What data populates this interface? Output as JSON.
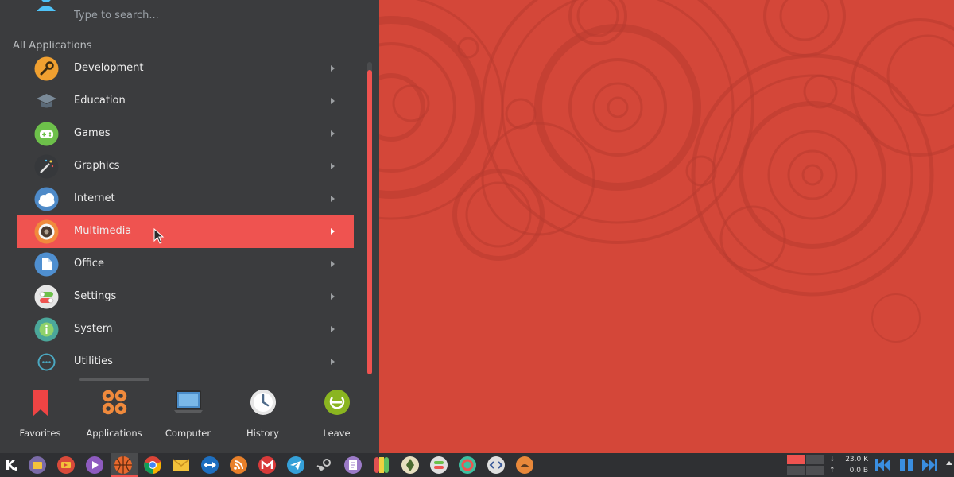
{
  "search": {
    "placeholder": "Type to search..."
  },
  "section_title": "All Applications",
  "categories": [
    {
      "label": "Development",
      "icon": "wrench-icon",
      "color": "#f0a030"
    },
    {
      "label": "Education",
      "icon": "graduation-cap-icon",
      "color": "#5b6a78"
    },
    {
      "label": "Games",
      "icon": "gamepad-icon",
      "color": "#6dc04a"
    },
    {
      "label": "Graphics",
      "icon": "magic-wand-icon",
      "color": "#3a3a3a"
    },
    {
      "label": "Internet",
      "icon": "cloud-globe-icon",
      "color": "#4e8ac8"
    },
    {
      "label": "Multimedia",
      "icon": "speaker-icon",
      "color": "#f08a3c",
      "active": true
    },
    {
      "label": "Office",
      "icon": "document-icon",
      "color": "#4f8fd0"
    },
    {
      "label": "Settings",
      "icon": "toggle-switches-icon",
      "color": "#e6e6e6"
    },
    {
      "label": "System",
      "icon": "info-icon",
      "color": "#4ba79a"
    },
    {
      "label": "Utilities",
      "icon": "dots-icon",
      "color": "#3a3a3a"
    }
  ],
  "bottom_nav": [
    {
      "label": "Favorites",
      "icon": "bookmark-icon"
    },
    {
      "label": "Applications",
      "icon": "applications-grid-icon"
    },
    {
      "label": "Computer",
      "icon": "laptop-icon"
    },
    {
      "label": "History",
      "icon": "clock-icon"
    },
    {
      "label": "Leave",
      "icon": "power-icon"
    }
  ],
  "taskbar": {
    "apps": [
      {
        "name": "kde-menu-icon",
        "color": "#ffffff"
      },
      {
        "name": "file-manager-icon",
        "color": "#7b6ba8"
      },
      {
        "name": "video-player-icon",
        "color": "#d94a3a"
      },
      {
        "name": "media-player-icon",
        "color": "#8e5bc0"
      },
      {
        "name": "basketball-icon",
        "color": "#e8682c"
      },
      {
        "name": "chrome-icon",
        "color": "#4285f4"
      },
      {
        "name": "mail-icon",
        "color": "#f3c23a"
      },
      {
        "name": "teamviewer-icon",
        "color": "#1e6fc0"
      },
      {
        "name": "rss-icon",
        "color": "#e8802a"
      },
      {
        "name": "gmail-icon",
        "color": "#d93a3a"
      },
      {
        "name": "telegram-icon",
        "color": "#35a0d8"
      },
      {
        "name": "steam-icon",
        "color": "#c8c8c8"
      },
      {
        "name": "text-editor-icon",
        "color": "#9c7bc8"
      },
      {
        "name": "color-picker-icon",
        "color": "#d8c040"
      },
      {
        "name": "inkscape-icon",
        "color": "#e8e0c0"
      },
      {
        "name": "settings-toggle-icon",
        "color": "#e0e0e0"
      },
      {
        "name": "system-gear-icon",
        "color": "#3cc0a0"
      },
      {
        "name": "code-editor-icon",
        "color": "#e0e0e0"
      },
      {
        "name": "cat-icon",
        "color": "#e8883a"
      }
    ],
    "network": {
      "down": "23.0 K",
      "up": "0.0 B",
      "down_arrow": "↓",
      "up_arrow": "↑"
    }
  },
  "colors": {
    "accent": "#ef5350",
    "panel": "#3b3c3e",
    "wallpaper": "#d44739",
    "taskbar": "#2f3033"
  }
}
